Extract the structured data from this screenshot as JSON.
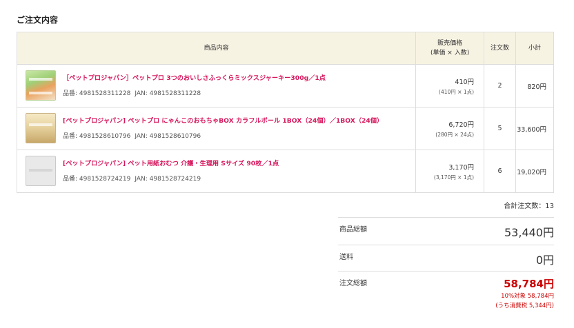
{
  "section_title": "ご注文内容",
  "table": {
    "headers": {
      "item": "商品内容",
      "price_line1": "販売価格",
      "price_line2": "(単価 × 入数)",
      "qty": "注文数",
      "subtotal": "小計"
    },
    "rows": [
      {
        "thumb": "jerky-bag-image",
        "name": "［ペットプロジャパン］ペットプロ 3つのおいしさふっくらミックスジャーキー300g／1点",
        "sku": "品番: 4981528311228",
        "jan": "JAN: 4981528311228",
        "unit_price": "410円",
        "unit_detail": "(410円 × 1点)",
        "qty": "2",
        "subtotal": "820円"
      },
      {
        "thumb": "toy-box-image",
        "name": "[ペットプロジャパン] ペットプロ にゃんこのおもちゃBOX カラフルボール 1BOX（24個）／1BOX（24個）",
        "sku": "品番: 4981528610796",
        "jan": "JAN: 4981528610796",
        "unit_price": "6,720円",
        "unit_detail": "(280円 × 24点)",
        "qty": "5",
        "subtotal": "33,600円"
      },
      {
        "thumb": "diaper-pack-image",
        "name": "[ペットプロジャパン] ペット用紙おむつ 介護・生理用 Sサイズ 90枚／1点",
        "sku": "品番: 4981528724219",
        "jan": "JAN: 4981528724219",
        "unit_price": "3,170円",
        "unit_detail": "(3,170円 × 1点)",
        "qty": "6",
        "subtotal": "19,020円"
      }
    ]
  },
  "total_qty": "合計注文数：13",
  "summary": {
    "goods_label": "商品総額",
    "goods_value": "53,440円",
    "shipping_label": "送料",
    "shipping_value": "0円",
    "total_label": "注文総額",
    "total_value": "58,784円",
    "tax_line1": "10%対象 58,784円",
    "tax_line2": "(うち消費税 5,344円)"
  },
  "colors": {
    "item_name": "#d6175d",
    "total": "#cc0000",
    "header_bg": "#f7f3e3"
  }
}
